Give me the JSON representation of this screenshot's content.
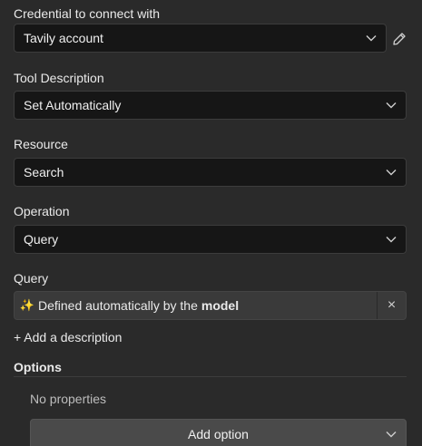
{
  "credential": {
    "label": "Credential to connect with",
    "value": "Tavily account"
  },
  "tool_description": {
    "label": "Tool Description",
    "value": "Set Automatically"
  },
  "resource": {
    "label": "Resource",
    "value": "Search"
  },
  "operation": {
    "label": "Operation",
    "value": "Query"
  },
  "query": {
    "label": "Query",
    "sparkle": "✨",
    "text": "Defined automatically by the",
    "bold_text": "model",
    "clear_glyph": "×"
  },
  "add_description": "+ Add a description",
  "options": {
    "label": "Options",
    "empty_text": "No properties",
    "add_button": "Add option"
  }
}
